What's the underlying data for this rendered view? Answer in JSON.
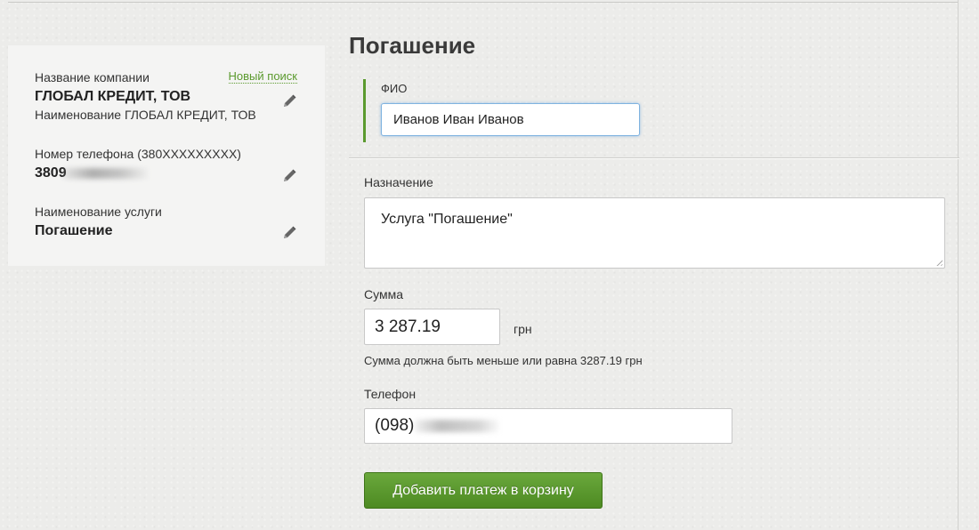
{
  "summary": {
    "company_label": "Название компании",
    "new_search": "Новый поиск",
    "company_name": "ГЛОБАЛ КРЕДИТ, ТОВ",
    "company_full": "Наименование ГЛОБАЛ КРЕДИТ, ТОВ",
    "phone_label": "Номер телефона (380XXXXXXXXX)",
    "phone_value": "3809",
    "service_label": "Наименование услуги",
    "service_value": "Погашение"
  },
  "form": {
    "title": "Погашение",
    "fio_label": "ФИО",
    "fio_value": "Иванов Иван Иванов",
    "purpose_label": "Назначение",
    "purpose_value": "Услуга \"Погашение\"",
    "amount_label": "Сумма",
    "amount_value": "3 287.19",
    "currency": "грн",
    "amount_hint": "Сумма должна быть меньше или равна 3287.19 грн",
    "phone_label": "Телефон",
    "phone_value": "(098)",
    "submit_label": "Добавить платеж в корзину"
  },
  "colors": {
    "accent_green": "#5b9a2e",
    "button_green": "#5a9a2e",
    "focus_blue": "#7fb3e0"
  },
  "icons": {
    "edit": "pencil-icon"
  }
}
